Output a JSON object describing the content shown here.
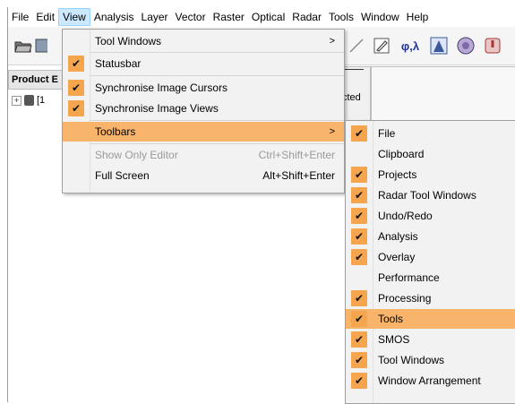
{
  "menubar": {
    "items": [
      "File",
      "Edit",
      "View",
      "Analysis",
      "Layer",
      "Vector",
      "Raster",
      "Optical",
      "Radar",
      "Tools",
      "Window",
      "Help"
    ],
    "open_item": "View"
  },
  "toolbar": {
    "icons": [
      "open-product-icon",
      "save-icon",
      "polyline-icon",
      "edit-icon",
      "band-maths-icon",
      "histogram-icon",
      "globe-icon",
      "help-icon"
    ],
    "phi_lambda_glyph": "φ,λ"
  },
  "product_panel": {
    "tab_label": "Product E",
    "tree_item": "[1",
    "side_text": "cted"
  },
  "view_menu": {
    "items": [
      {
        "label": "Tool Windows",
        "checked": false,
        "submenu": true,
        "shortcut": ""
      },
      {
        "label": "Statusbar",
        "checked": true,
        "submenu": false,
        "shortcut": ""
      },
      {
        "label": "Synchronise Image Cursors",
        "checked": true,
        "submenu": false,
        "shortcut": ""
      },
      {
        "label": "Synchronise Image Views",
        "checked": true,
        "submenu": false,
        "shortcut": ""
      },
      {
        "label": "Toolbars",
        "checked": false,
        "submenu": true,
        "shortcut": "",
        "highlighted": true
      },
      {
        "label": "Show Only Editor",
        "checked": false,
        "submenu": false,
        "shortcut": "Ctrl+Shift+Enter",
        "disabled": true
      },
      {
        "label": "Full Screen",
        "checked": false,
        "submenu": false,
        "shortcut": "Alt+Shift+Enter"
      }
    ]
  },
  "toolbars_menu": {
    "items": [
      {
        "label": "File",
        "checked": true
      },
      {
        "label": "Clipboard",
        "checked": false
      },
      {
        "label": "Projects",
        "checked": true
      },
      {
        "label": "Radar Tool Windows",
        "checked": true
      },
      {
        "label": "Undo/Redo",
        "checked": true
      },
      {
        "label": "Analysis",
        "checked": true
      },
      {
        "label": "Overlay",
        "checked": true
      },
      {
        "label": "Performance",
        "checked": false
      },
      {
        "label": "Processing",
        "checked": true
      },
      {
        "label": "Tools",
        "checked": true,
        "highlighted": true
      },
      {
        "label": "SMOS",
        "checked": true
      },
      {
        "label": "Tool Windows",
        "checked": true
      },
      {
        "label": "Window Arrangement",
        "checked": true
      }
    ]
  },
  "colors": {
    "check_orange": "#f4a54d",
    "highlight_orange": "#f8b46a",
    "menu_bg": "#f2f2f2"
  }
}
